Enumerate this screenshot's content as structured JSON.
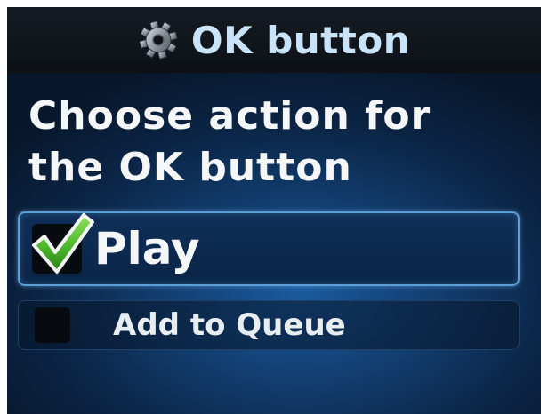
{
  "header": {
    "title": "OK button",
    "icon": "gear-icon"
  },
  "prompt": {
    "line1": "Choose action for",
    "line2": "the OK button"
  },
  "options": [
    {
      "label": "Play",
      "checked": true
    },
    {
      "label": "Add to Queue",
      "checked": false
    }
  ],
  "colors": {
    "title_text": "#c9e4f8",
    "selection_border": "#5b9fd6",
    "checkmark_green": "#4cb82c"
  }
}
